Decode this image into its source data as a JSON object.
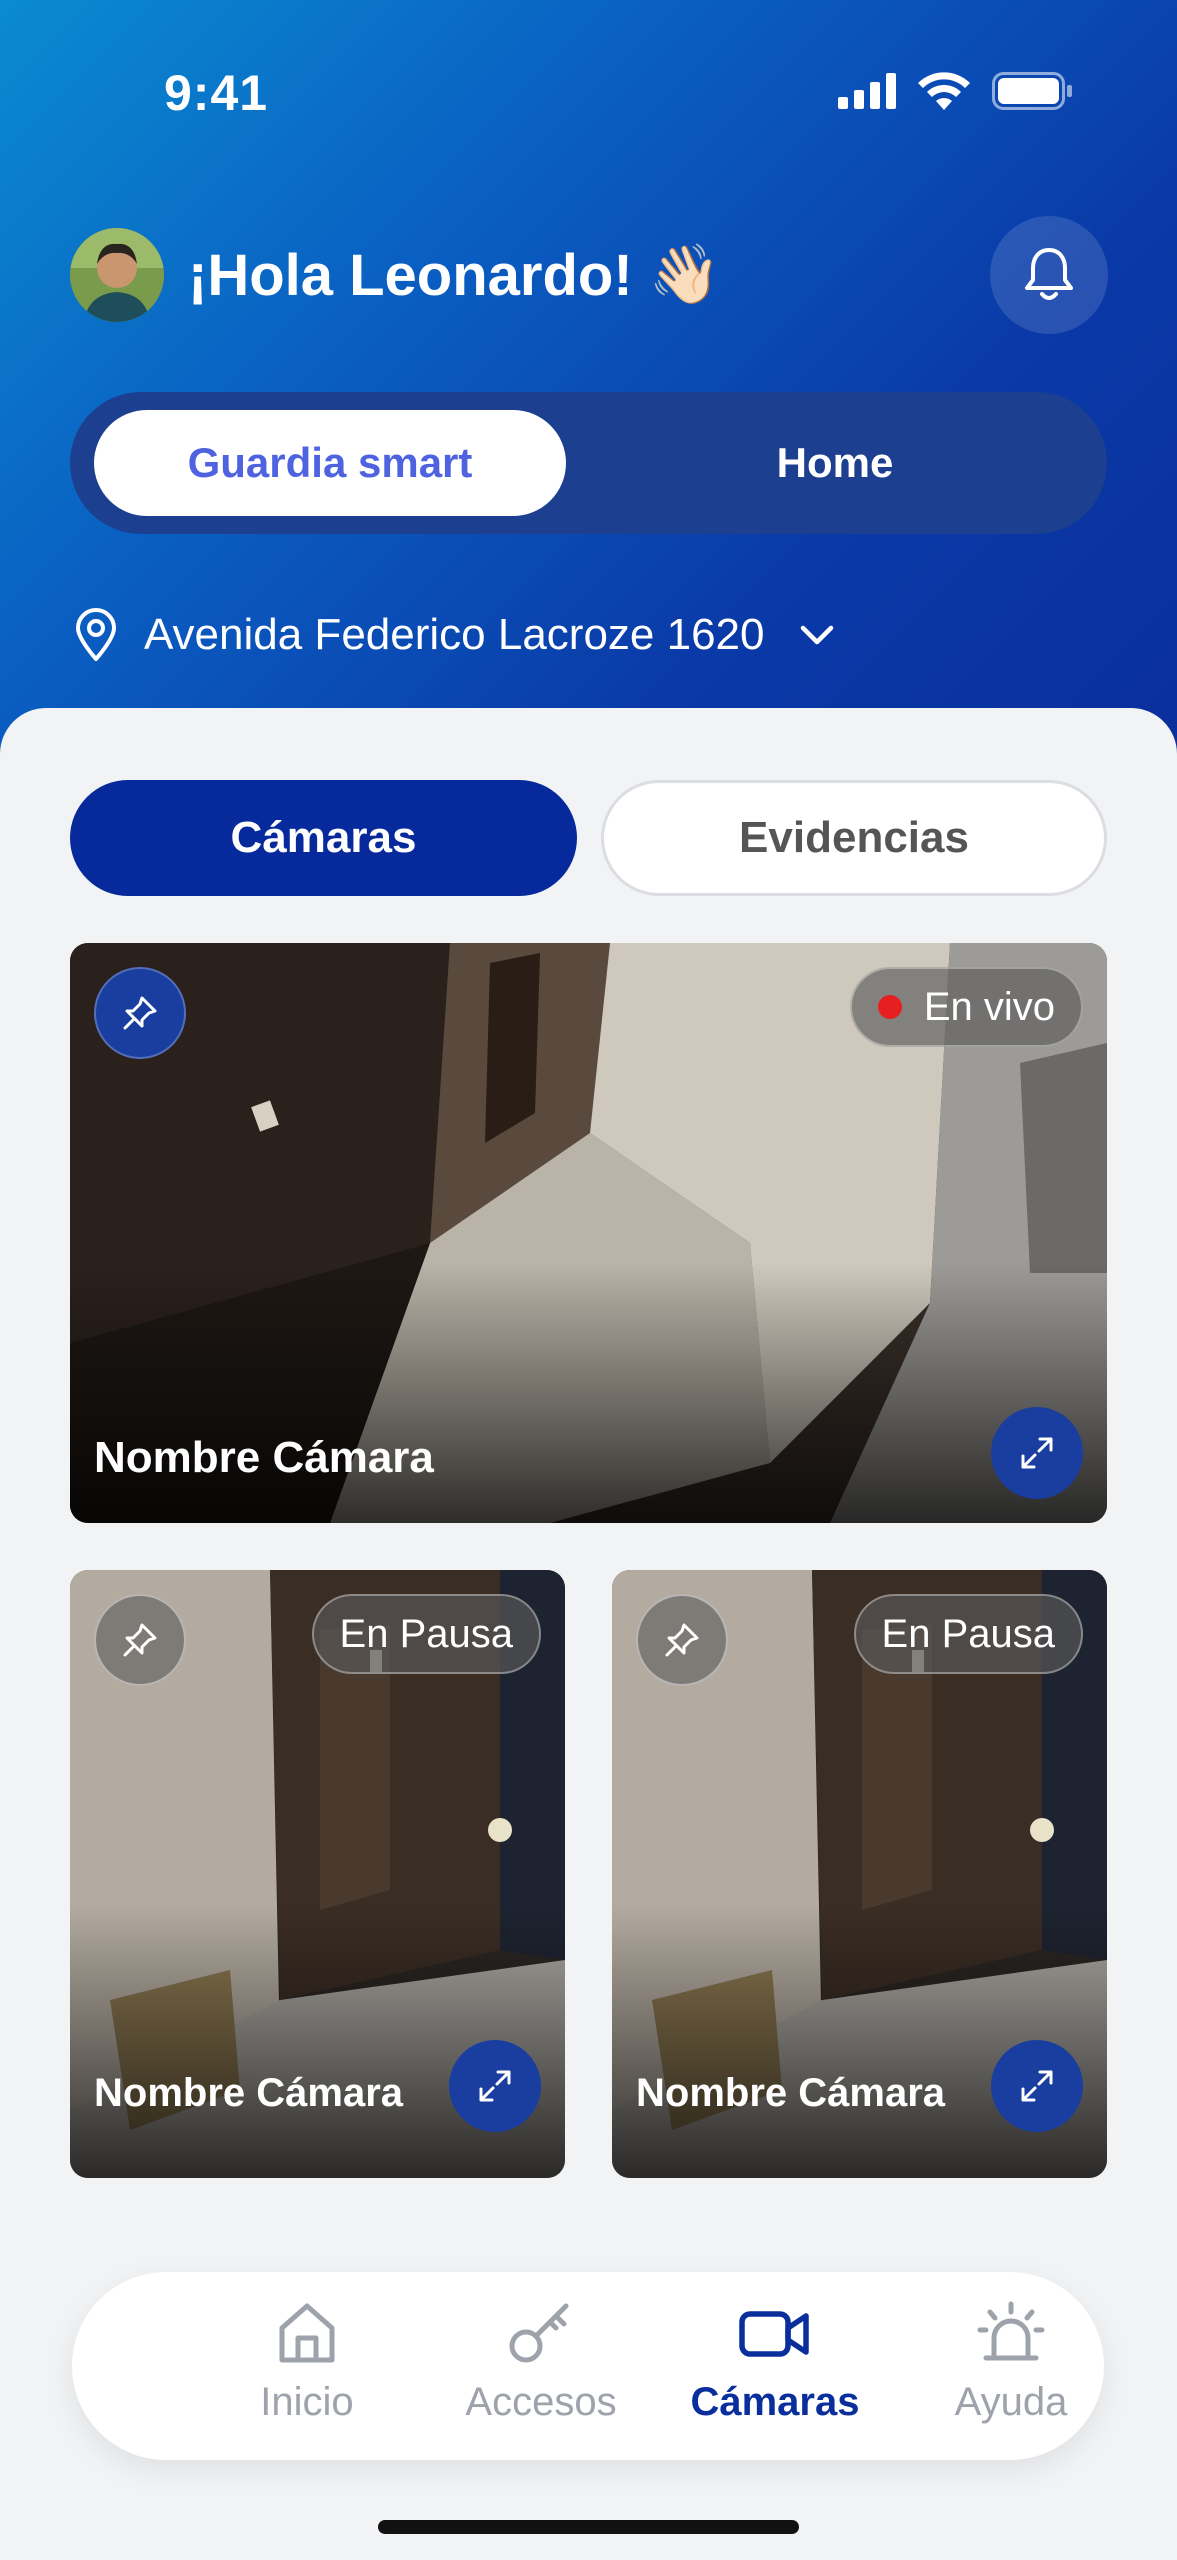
{
  "status_bar": {
    "time": "9:41"
  },
  "header": {
    "greeting": "¡Hola Leonardo!",
    "greeting_emoji": "👋🏻",
    "segments": {
      "active": "Guardia smart",
      "inactive": "Home"
    },
    "location": "Avenida Federico Lacroze 1620"
  },
  "tabs": {
    "active": "Cámaras",
    "inactive": "Evidencias"
  },
  "cameras": [
    {
      "name": "Nombre Cámara",
      "status": "En vivo"
    },
    {
      "name": "Nombre Cámara",
      "status": "En Pausa"
    },
    {
      "name": "Nombre Cámara",
      "status": "En Pausa"
    }
  ],
  "bottom_nav": {
    "items": [
      {
        "label": "Inicio",
        "icon": "home-icon"
      },
      {
        "label": "Accesos",
        "icon": "key-icon"
      },
      {
        "label": "Cámaras",
        "icon": "video-camera-icon"
      },
      {
        "label": "Ayuda",
        "icon": "alarm-light-icon"
      }
    ],
    "active_index": 2
  },
  "colors": {
    "brand_dark": "#0a2f9c",
    "accent_text": "#4f63e0",
    "live_dot": "#e62020",
    "inactive_nav": "#9ea2ab"
  }
}
